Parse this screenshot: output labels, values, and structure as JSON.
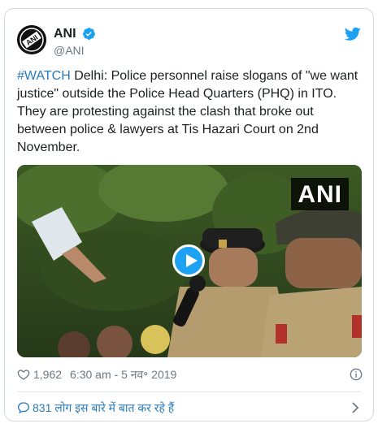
{
  "author": {
    "name": "ANI",
    "handle": "@ANI",
    "avatar_text": "ANI",
    "verified": true
  },
  "tweet": {
    "hashtag": "#WATCH",
    "text": " Delhi: Police personnel raise slogans of \"we want justice\" outside the Police Head Quarters (PHQ) in ITO. They are protesting against the clash that broke out between police & lawyers at Tis Hazari Court on 2nd November."
  },
  "media": {
    "watermark": "ANI",
    "type": "video",
    "play_icon": "play-icon"
  },
  "meta": {
    "likes": "1,962",
    "timestamp": "6:30 am - 5 नव॰ 2019"
  },
  "footer": {
    "conversation_text": "831 लोग इस बारे में बात कर रहे हैं"
  },
  "colors": {
    "accent": "#1da1f2",
    "link": "#2b7bb9",
    "muted": "#697882",
    "border": "#cfd9de"
  },
  "icons": {
    "brand": "twitter-bird-icon",
    "verified": "verified-badge-icon",
    "like": "heart-icon",
    "info": "info-icon",
    "reply": "reply-bubble-icon",
    "more": "chevron-right-icon"
  }
}
